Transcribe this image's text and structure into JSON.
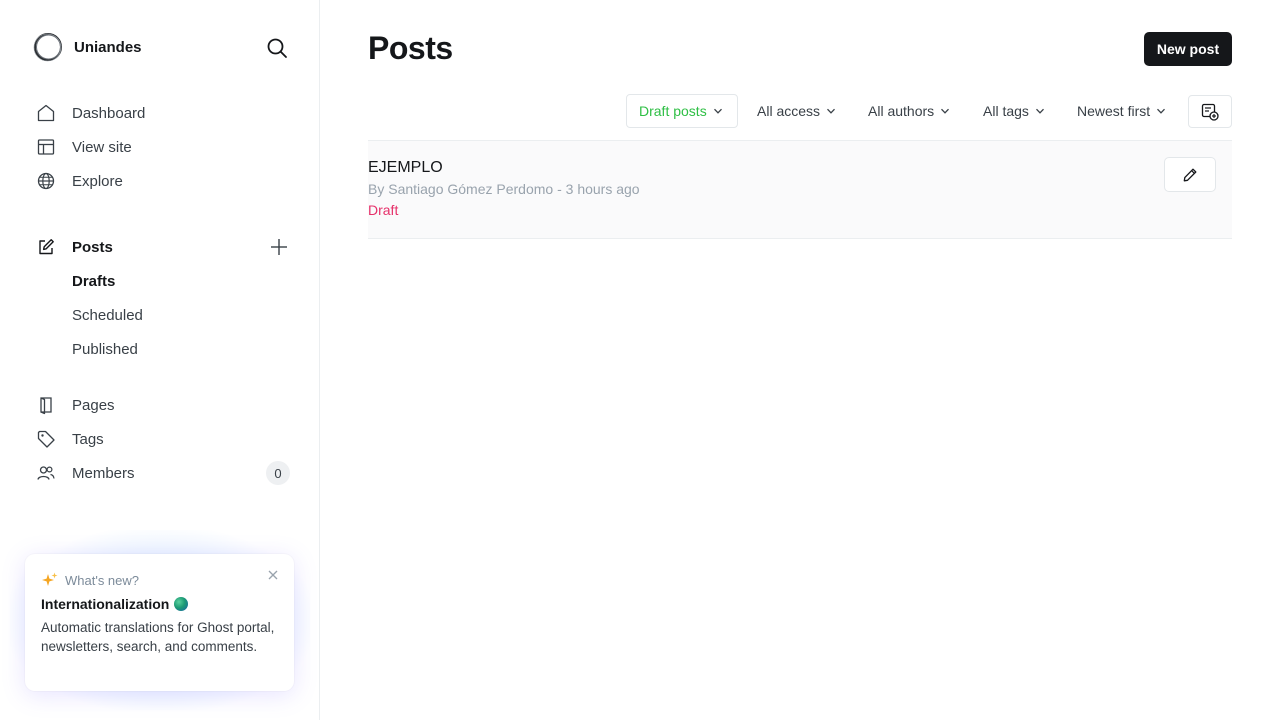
{
  "brand": {
    "name": "Uniandes"
  },
  "sidebar": {
    "nav": [
      {
        "label": "Dashboard",
        "icon": "house-icon"
      },
      {
        "label": "View site",
        "icon": "layout-icon"
      },
      {
        "label": "Explore",
        "icon": "globe-icon"
      }
    ],
    "posts": {
      "label": "Posts",
      "icon": "edit-icon"
    },
    "post_subitems": [
      {
        "label": "Drafts",
        "active": true
      },
      {
        "label": "Scheduled",
        "active": false
      },
      {
        "label": "Published",
        "active": false
      }
    ],
    "secondary": [
      {
        "label": "Pages",
        "icon": "page-icon"
      },
      {
        "label": "Tags",
        "icon": "tag-icon"
      },
      {
        "label": "Members",
        "icon": "members-icon",
        "count": "0"
      }
    ]
  },
  "whats_new": {
    "heading": "What's new?",
    "title": "Internationalization",
    "body": "Automatic translations for Ghost portal, newsletters, search, and comments."
  },
  "main": {
    "title": "Posts",
    "new_post_label": "New post",
    "filters": {
      "type": "Draft posts",
      "access": "All access",
      "authors": "All authors",
      "tags": "All tags",
      "sort": "Newest first"
    },
    "posts": [
      {
        "title": "EJEMPLO",
        "meta": "By Santiago Gómez Perdomo - 3 hours ago",
        "status": "Draft"
      }
    ]
  },
  "colors": {
    "accent_green": "#30cf43",
    "draft_pink": "#e6306a",
    "primary_dark": "#15171a"
  }
}
